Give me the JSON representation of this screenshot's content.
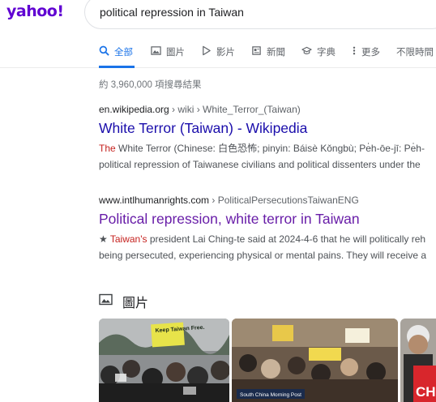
{
  "logo": "yahoo!",
  "search": {
    "query": "political repression in Taiwan"
  },
  "tabs": [
    {
      "label": "全部",
      "icon": "search-icon",
      "active": true
    },
    {
      "label": "圖片",
      "icon": "image-icon"
    },
    {
      "label": "影片",
      "icon": "play-icon"
    },
    {
      "label": "新聞",
      "icon": "news-icon"
    },
    {
      "label": "字典",
      "icon": "graduation-cap-icon"
    },
    {
      "label": "更多",
      "icon": "more-vert-icon"
    },
    {
      "label": "不限時間"
    }
  ],
  "stats": "約 3,960,000 項搜尋結果",
  "results": [
    {
      "domain": "en.wikipedia.org",
      "path": " › wiki › White_Terror_(Taiwan)",
      "title": "White Terror (Taiwan) - Wikipedia",
      "snippet_hl": "The",
      "snippet_1": " White Terror (Chinese: 白色恐怖; pinyin: Báisè Kǒngbù; Pe̍h-ōe-jī: Pe̍h-",
      "snippet_2": "political repression of Taiwanese civilians and political dissenters under the"
    },
    {
      "domain": "www.intlhumanrights.com",
      "path": " › PoliticalPersecutionsTaiwanENG",
      "title": "Political repression, white terror in Taiwan",
      "snippet_pre": "★ ",
      "snippet_hl": "Taiwan's",
      "snippet_1": " president Lai Ching-te said at 2024-4-6 that he will politically reh",
      "snippet_2": "being persecuted, experiencing physical or mental pains. They will receive a"
    }
  ],
  "images_section": {
    "label": "圖片",
    "thumb1_sign": "Keep Taiwan Free.",
    "thumb2_caption": "South China Morning Post",
    "thumb3_text": "CH"
  }
}
